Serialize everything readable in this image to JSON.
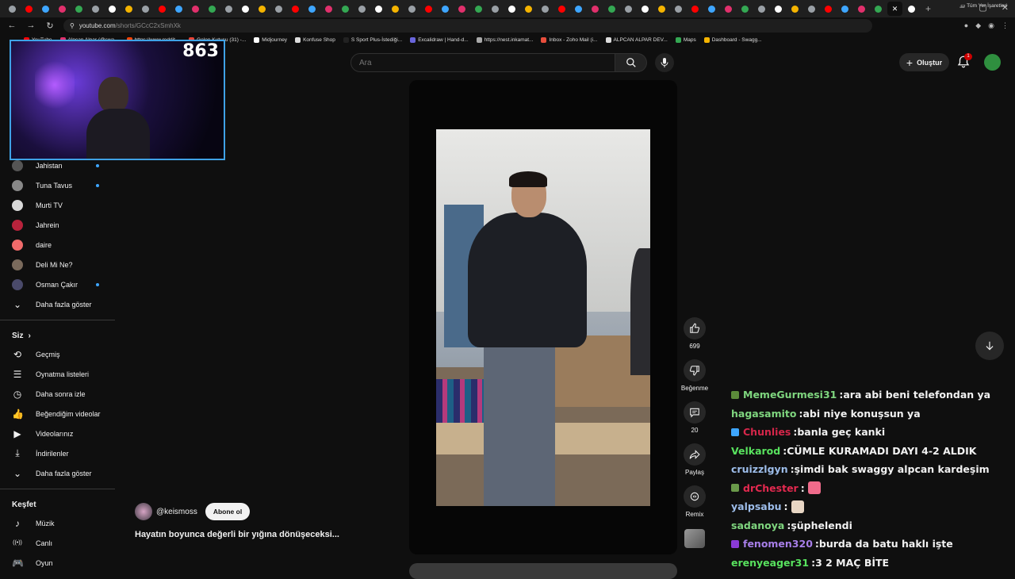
{
  "browser": {
    "tab_count": 55,
    "new_tab": "+",
    "window_controls": [
      "–",
      "▢",
      "✕"
    ],
    "url_domain": "youtube.com",
    "url_path": "/shorts/GCcC2xSmhXk"
  },
  "bookmarks": {
    "items": [
      {
        "label": "YouTube",
        "color": "#ff0000"
      },
      {
        "label": "Alpcan Alpar (@swa...",
        "color": "#e1306c"
      },
      {
        "label": "https://www.reddit....",
        "color": "#ff4500"
      },
      {
        "label": "Gelen Kutusu (31) -...",
        "color": "#ea4335"
      },
      {
        "label": "Midjourney",
        "color": "#ffffff"
      },
      {
        "label": "Konfuse Shop",
        "color": "#dddddd"
      },
      {
        "label": "S Sport Plus-İstediği...",
        "color": "#222222"
      },
      {
        "label": "Excalidraw | Hand-d...",
        "color": "#6965db"
      },
      {
        "label": "https://nest.inkamat...",
        "color": "#aaaaaa"
      },
      {
        "label": "Inbox - Zoho Mail (i...",
        "color": "#e84e3c"
      },
      {
        "label": "ALPCAN ALPAR DEV...",
        "color": "#dddddd"
      },
      {
        "label": "Maps",
        "color": "#34a853"
      },
      {
        "label": "Dashboard - Swagg...",
        "color": "#f5b400"
      }
    ],
    "all_bookmarks": "Tüm Yer İşaretleri"
  },
  "webcam": {
    "counter": "863"
  },
  "sidebar": {
    "subscriptions": [
      {
        "label": "Jahistan",
        "live": true,
        "color": "#555555"
      },
      {
        "label": "Tuna Tavus",
        "live": true,
        "color": "#888888"
      },
      {
        "label": "Murti TV",
        "live": false,
        "color": "#d9d9d9"
      },
      {
        "label": "Jahrein",
        "live": false,
        "color": "#b8233c"
      },
      {
        "label": "daire",
        "live": false,
        "color": "#f06b6b"
      },
      {
        "label": "Deli Mi Ne?",
        "live": false,
        "color": "#7a6a5c"
      },
      {
        "label": "Osman Çakır",
        "live": true,
        "color": "#4a4a6a"
      }
    ],
    "show_more_1": "Daha fazla göster",
    "you_heading": "Siz",
    "you_items": [
      {
        "label": "Geçmiş",
        "icon": "history-icon",
        "glyph": "⟲"
      },
      {
        "label": "Oynatma listeleri",
        "icon": "playlists-icon",
        "glyph": "☰"
      },
      {
        "label": "Daha sonra izle",
        "icon": "watch-later-icon",
        "glyph": "◷"
      },
      {
        "label": "Beğendiğim videolar",
        "icon": "liked-icon",
        "glyph": "👍"
      },
      {
        "label": "Videolarınız",
        "icon": "your-videos-icon",
        "glyph": "▶"
      },
      {
        "label": "İndirilenler",
        "icon": "downloads-icon",
        "glyph": "⤓"
      }
    ],
    "show_more_2": "Daha fazla göster",
    "explore_heading": "Keşfet",
    "explore_items": [
      {
        "label": "Müzik",
        "icon": "music-icon",
        "glyph": "♪"
      },
      {
        "label": "Canlı",
        "icon": "live-icon",
        "glyph": "((•))"
      },
      {
        "label": "Oyun",
        "icon": "gaming-icon",
        "glyph": "🎮"
      }
    ]
  },
  "header": {
    "search_placeholder": "Ara",
    "create_label": "Oluştur",
    "notification_count": "1"
  },
  "short": {
    "channel": "@keismoss",
    "subscribe_label": "Abone ol",
    "title": "Hayatın boyunca değerli bir yığına dönüşeceksi...",
    "likes": "699",
    "dislike_label": "Beğenme",
    "comments": "20",
    "share_label": "Paylaş",
    "remix_label": "Remix"
  },
  "chat": {
    "messages": [
      {
        "user": "MemeGurmesi31",
        "text": "ara abi beni telefondan ya",
        "color": "#7fd67f",
        "badge": "#5c8a3a",
        "partial": true
      },
      {
        "user": "hagasamito",
        "text": "abi niye konuşsun ya",
        "color": "#7fd67f",
        "badge": ""
      },
      {
        "user": "Chunlies",
        "text": "banla geç kanki",
        "color": "#d6264a",
        "badge": "#3ea6ff"
      },
      {
        "user": "Velkarod",
        "text": "CÜMLE KURAMADI DAYI 4-2 ALDIK",
        "color": "#58e25e",
        "badge": ""
      },
      {
        "user": "cruizzlgyn",
        "text": "şimdi bak swaggy alpcan kardeşim",
        "color": "#9dbdea",
        "badge": ""
      },
      {
        "user": "drChester",
        "text": "",
        "color": "#e3294f",
        "badge": "#6a9a4a",
        "emote": "#f06b8b"
      },
      {
        "user": "yalpsabu",
        "text": "",
        "color": "#9dbdea",
        "badge": "",
        "emote": "#e8d6c4"
      },
      {
        "user": "sadanoya",
        "text": "şüphelendi",
        "color": "#7fd67f",
        "badge": ""
      },
      {
        "user": "fenomen320",
        "text": "burda da batu haklı işte",
        "color": "#a77ee8",
        "badge": "#8a3ad6"
      },
      {
        "user": "erenyeager31",
        "text": "3 2 MAÇ BİTE",
        "color": "#58e25e",
        "badge": ""
      }
    ]
  }
}
